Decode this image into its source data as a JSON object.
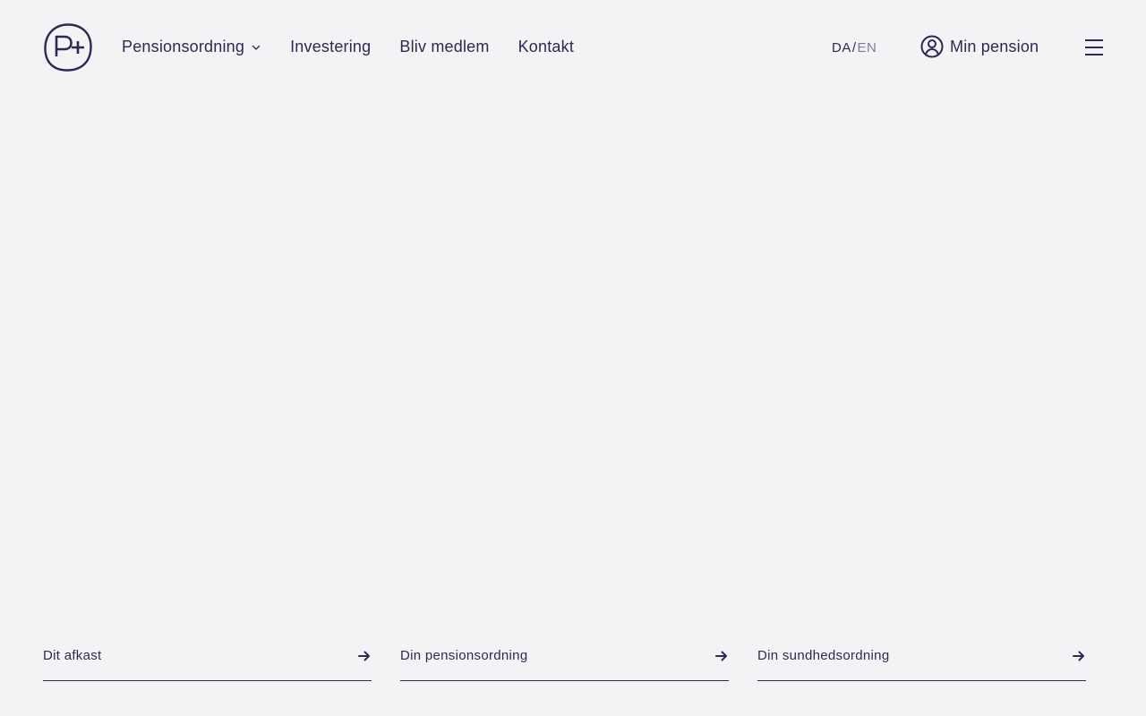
{
  "brand": {
    "logo_text": "P+",
    "colors": {
      "primary": "#2b2a52",
      "background": "#f3f3f6",
      "muted": "#7d7c98"
    }
  },
  "nav": {
    "items": [
      {
        "label": "Pensionsordning",
        "has_dropdown": true
      },
      {
        "label": "Investering",
        "has_dropdown": false
      },
      {
        "label": "Bliv medlem",
        "has_dropdown": false
      },
      {
        "label": "Kontakt",
        "has_dropdown": false
      }
    ]
  },
  "language": {
    "active": "DA",
    "separator": "/",
    "inactive": "EN"
  },
  "login": {
    "label": "Min pension",
    "icon": "user-circle-icon"
  },
  "menu": {
    "icon": "hamburger-icon"
  },
  "quicklinks": [
    {
      "label": "Dit afkast",
      "icon": "arrow-right-icon"
    },
    {
      "label": "Din pensionsordning",
      "icon": "arrow-right-icon"
    },
    {
      "label": "Din sundhedsordning",
      "icon": "arrow-right-icon"
    }
  ]
}
